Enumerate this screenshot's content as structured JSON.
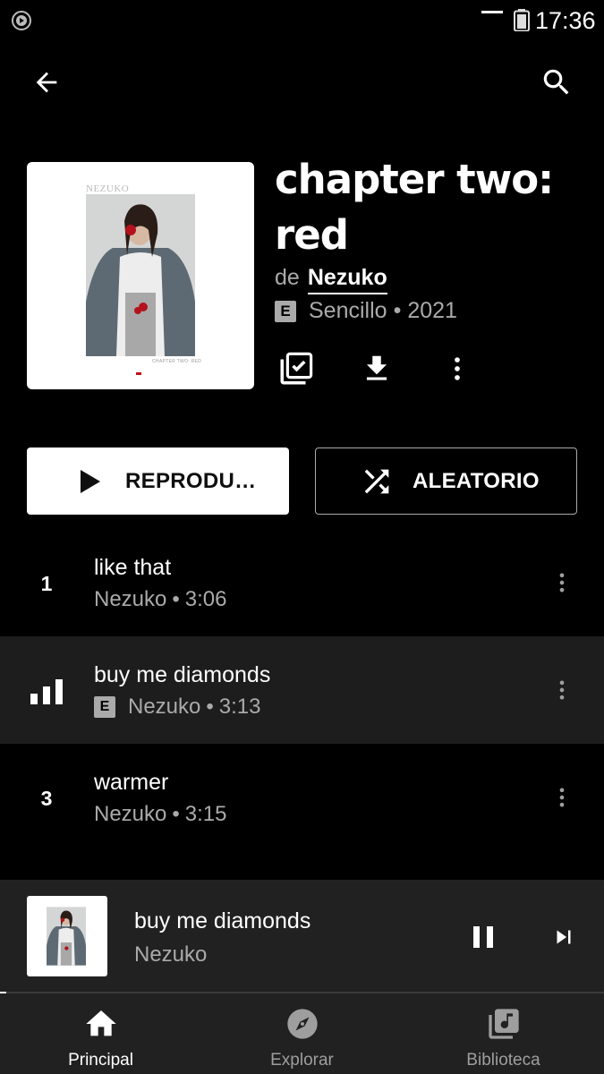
{
  "status_bar": {
    "time": "17:36"
  },
  "album": {
    "title": "chapter two: red",
    "by_label": "de",
    "artist": "Nezuko",
    "explicit_label": "E",
    "type": "Sencillo",
    "separator": "•",
    "year": "2021",
    "art_brand": "NEZUKO",
    "art_caption": "CHAPTER TWO: RED"
  },
  "buttons": {
    "play_label": "REPRODU…",
    "shuffle_label": "ALEATORIO"
  },
  "tracks": [
    {
      "number": "1",
      "title": "like that",
      "artist": "Nezuko",
      "duration": "3:06",
      "explicit": false,
      "playing": false
    },
    {
      "number": "2",
      "title": "buy me diamonds",
      "artist": "Nezuko",
      "duration": "3:13",
      "explicit": true,
      "playing": true
    },
    {
      "number": "3",
      "title": "warmer",
      "artist": "Nezuko",
      "duration": "3:15",
      "explicit": false,
      "playing": false
    }
  ],
  "mini_player": {
    "title": "buy me diamonds",
    "artist": "Nezuko",
    "progress_fraction": 0.01
  },
  "bottom_nav": {
    "items": [
      {
        "label": "Principal",
        "icon": "home-icon",
        "selected": true
      },
      {
        "label": "Explorar",
        "icon": "compass-icon",
        "selected": false
      },
      {
        "label": "Biblioteca",
        "icon": "library-music-icon",
        "selected": false
      }
    ]
  },
  "colors": {
    "background": "#000000",
    "surface": "#212121",
    "active_row": "#1d1d1d",
    "secondary_text": "#aaaaaa",
    "accent_red": "#c2101a"
  }
}
